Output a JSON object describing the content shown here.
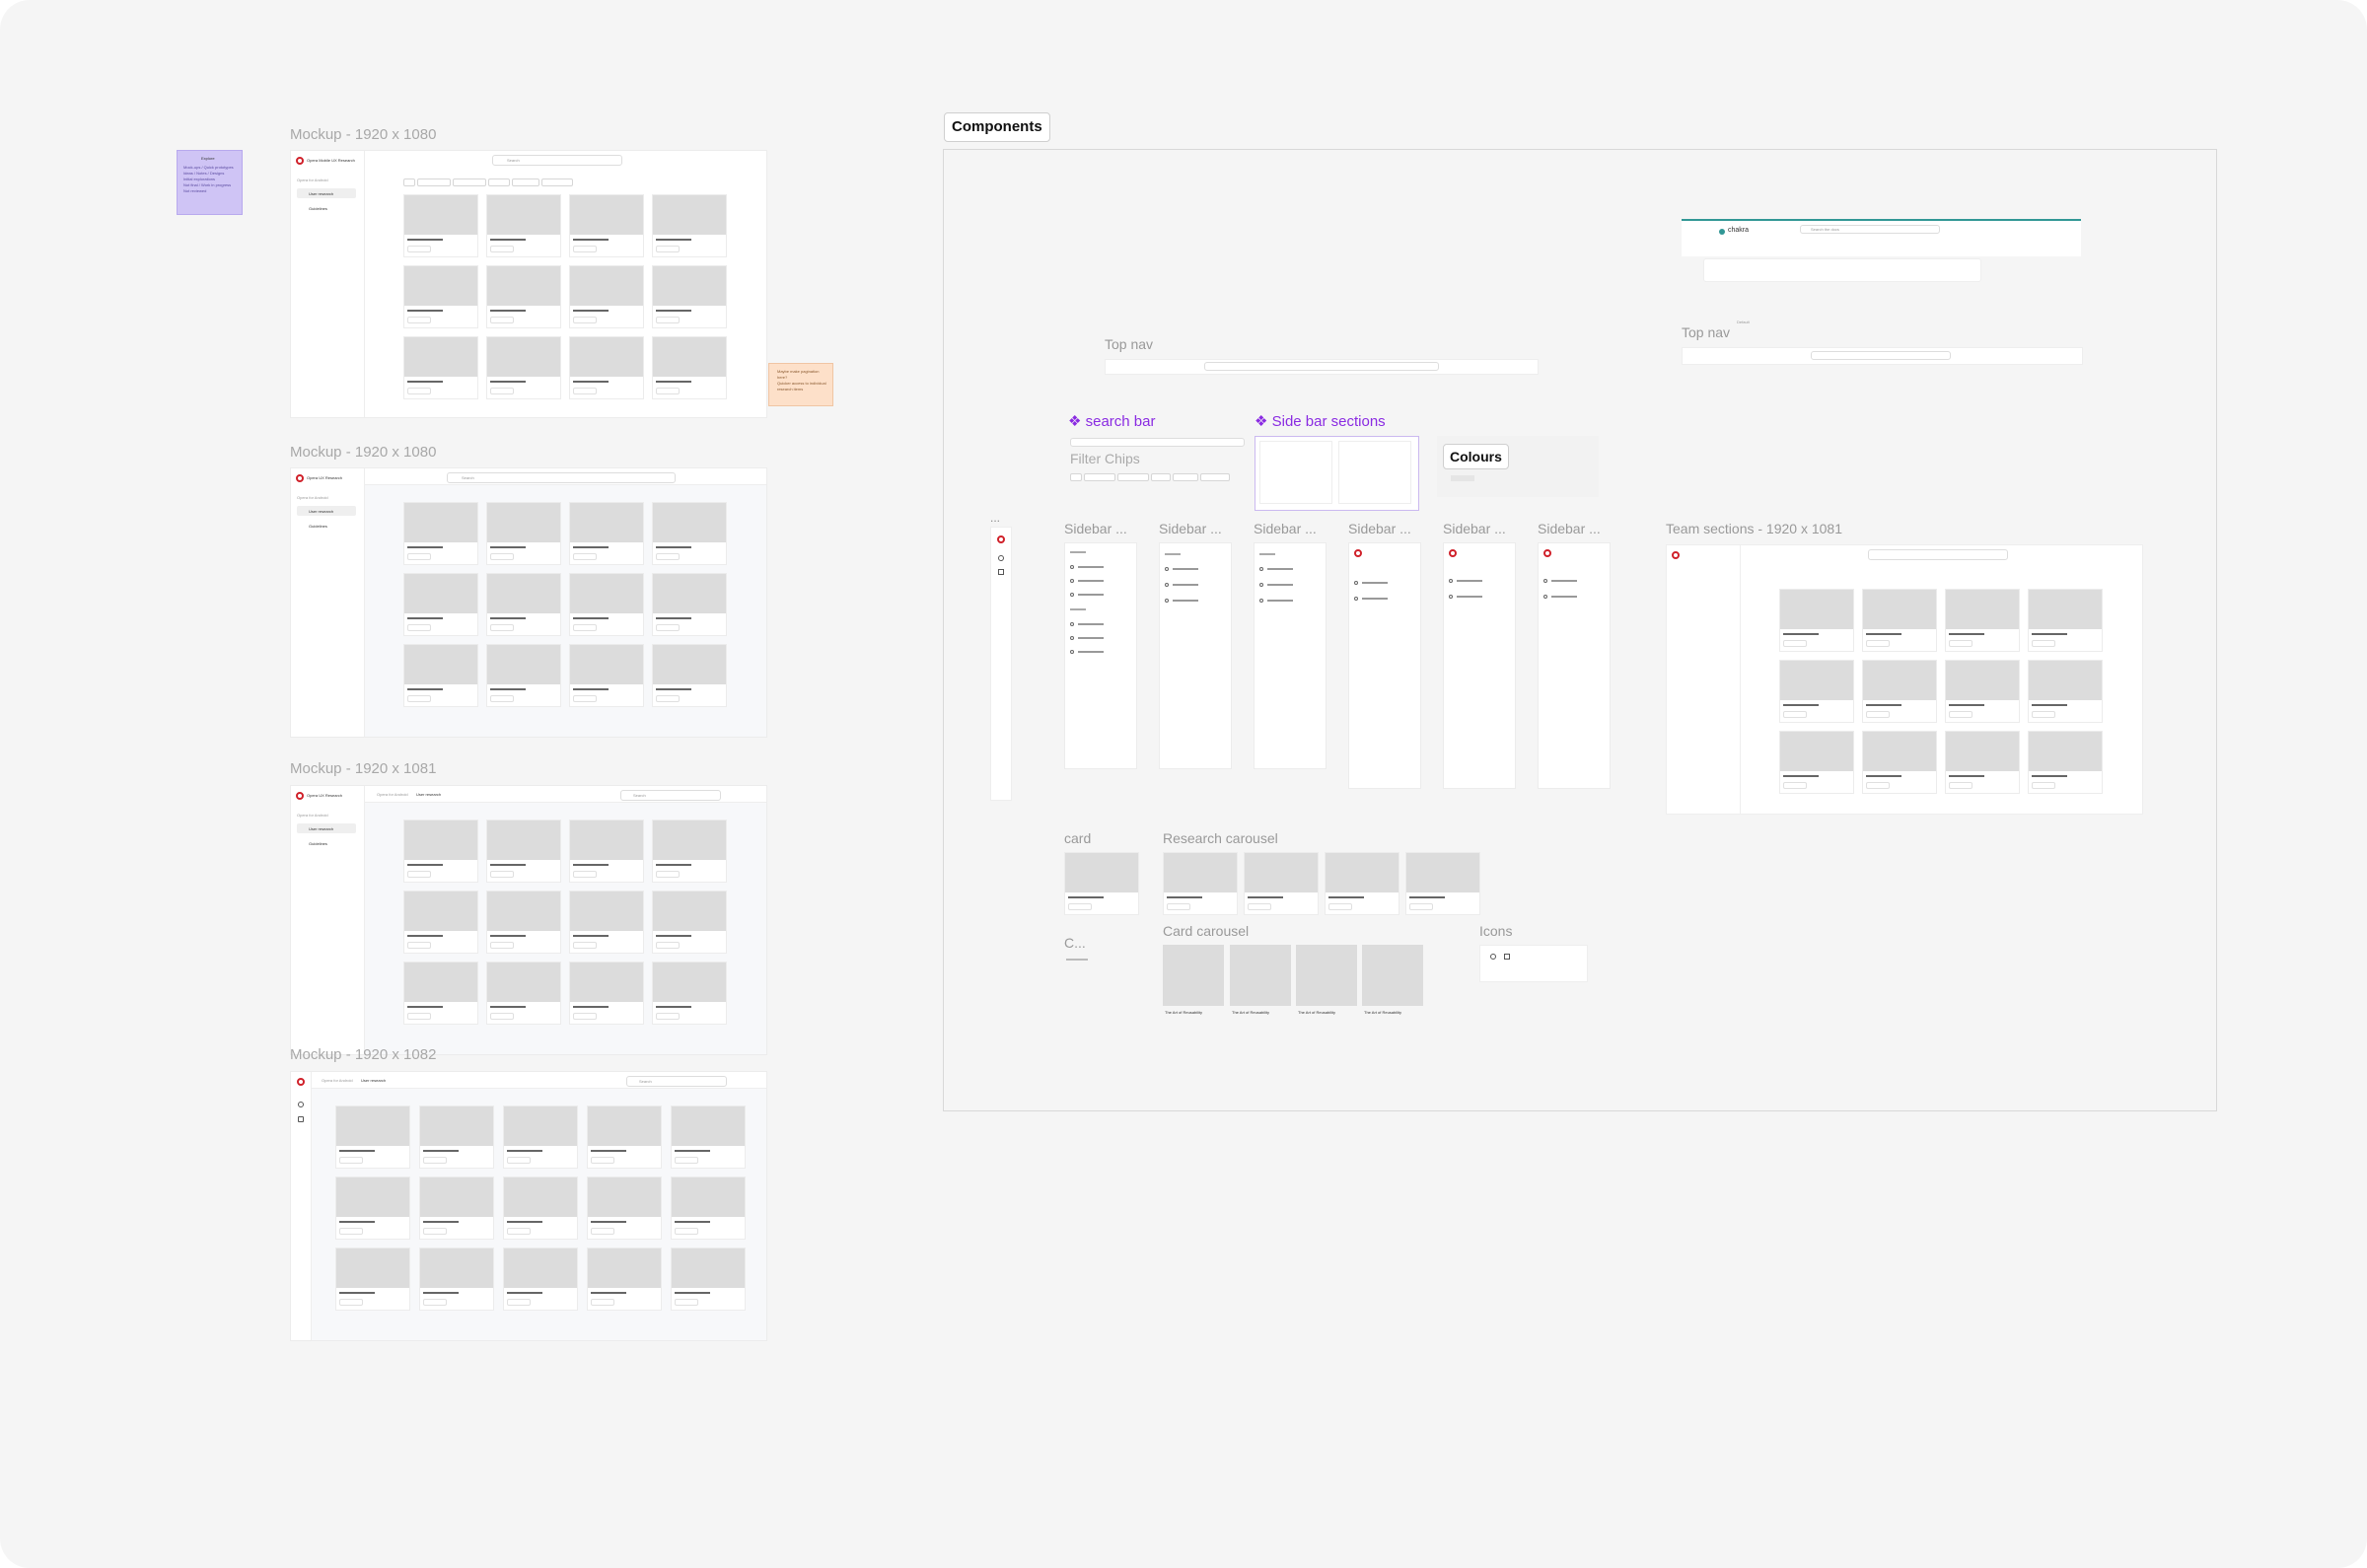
{
  "mockups": [
    {
      "label": "Mockup - 1920 x 1080",
      "brand": "Opera Mobile UX Research",
      "search_placeholder": "Search",
      "section": "Opera for Android",
      "nav": [
        "User research",
        "Guidelines"
      ],
      "chips": [
        "All",
        "Usability testing",
        "User interviews",
        "Surveys",
        "A/B Testing",
        "Brand studies"
      ],
      "card_title": "Boilerplate Research",
      "card_badge": "Usability testing"
    },
    {
      "label": "Mockup - 1920 x 1080",
      "brand": "Opera UX Research",
      "search_placeholder": "Search",
      "section": "Opera for Android",
      "nav": [
        "User research",
        "Guidelines"
      ],
      "card_title": "Boilerplate Research",
      "card_badge": "Usability testing"
    },
    {
      "label": "Mockup - 1920 x 1081",
      "brand": "Opera UX Research",
      "breadcrumb": [
        "Opera for Android",
        "User research"
      ],
      "search_placeholder": "Search",
      "section": "Opera for Android",
      "nav": [
        "User research",
        "Guidelines"
      ],
      "card_title": "Boilerplate Research",
      "card_badge": "Usability testing"
    },
    {
      "label": "Mockup - 1920 x 1082",
      "breadcrumb": [
        "Opera for Android",
        "User research"
      ],
      "search_placeholder": "Search",
      "card_title": "Boilerplate Research",
      "card_badge": "Usability testing"
    }
  ],
  "sticky_purple": {
    "title": "Explore",
    "lines": [
      "Mock-ups / Quick prototypes",
      "Ideas / Notes / Designs",
      "Initial explorations",
      "Not final / Work in progress",
      "Not reviewed"
    ]
  },
  "sticky_orange": {
    "lines": [
      "Maybe make pagination",
      "here?",
      "Quicker access to individual",
      "research items"
    ]
  },
  "components": {
    "title": "Components",
    "top_nav_label": "Top nav",
    "top_nav_label_2": "Top nav",
    "search_bar_label": "❖ search bar",
    "side_bar_sections_label": "❖ Side bar sections",
    "filter_chips_label": "Filter Chips",
    "colours_label": "Colours",
    "sidebar_labels": [
      "Sidebar ...",
      "Sidebar ...",
      "Sidebar ...",
      "Sidebar ...",
      "Sidebar ...",
      "Sidebar ..."
    ],
    "team_sections_label": "Team sections - 1920 x 1081",
    "card_label": "card",
    "research_carousel_label": "Research carousel",
    "c_label": "C...",
    "card_carousel_label": "Card carousel",
    "icons_label": "Icons",
    "ellipsis": "...",
    "chakra_brand": "chakra",
    "chakra_search": "Search the docs",
    "sidebar_groups": [
      "Discover",
      "Library",
      "Playlists"
    ],
    "sidebar_item": "Single-line item",
    "carousel_card_title": "The Art of Reusability",
    "colours_value": "Default"
  },
  "colors": {
    "canvas": "#f5f5f5",
    "purple_note": "#cfc4f5",
    "orange_note": "#fde0c9",
    "accent_purple": "#8a2be2",
    "opera_red": "#d0212a",
    "chakra_teal": "#319795"
  }
}
